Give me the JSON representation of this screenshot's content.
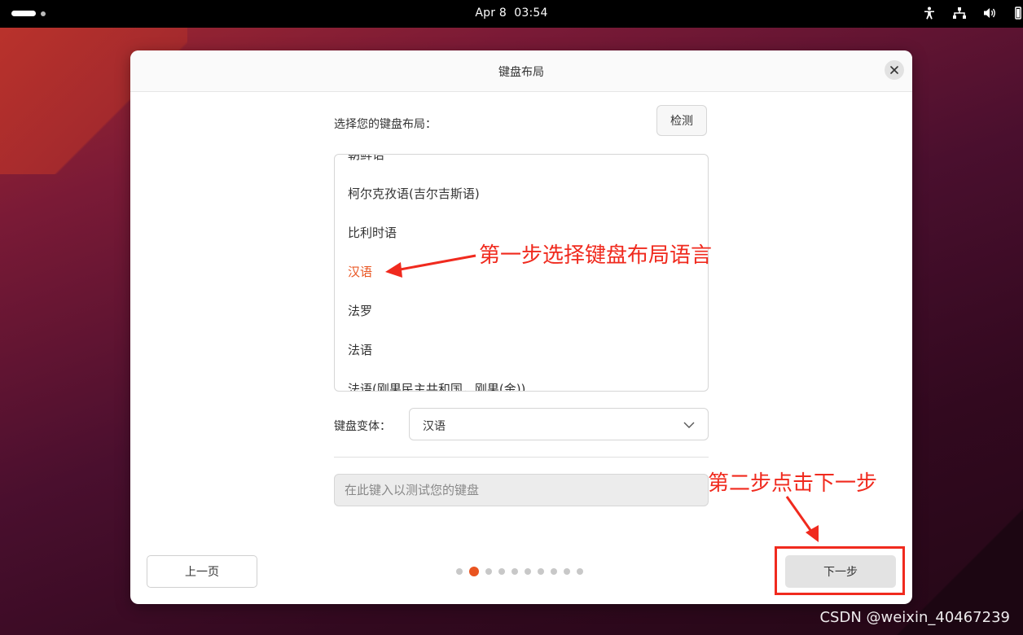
{
  "topbar": {
    "date": "Apr 8",
    "time": "03:54",
    "icons": [
      "accessibility-icon",
      "network-icon",
      "volume-icon",
      "battery-icon"
    ]
  },
  "dialog": {
    "title": "键盘布局",
    "prompt": "选择您的键盘布局：",
    "detect_label": "检测",
    "layouts": [
      "朝鲜语",
      "柯尔克孜语(吉尔吉斯语)",
      "比利时语",
      "汉语",
      "法罗",
      "法语",
      "法语(刚果民主共和国，刚果(金))"
    ],
    "selected_layout": "汉语",
    "variant_label": "键盘变体：",
    "variant_value": "汉语",
    "test_placeholder": "在此键入以测试您的键盘",
    "back_label": "上一页",
    "next_label": "下一步",
    "pager": {
      "total": 10,
      "current": 2
    }
  },
  "annotations": {
    "step1": "第一步选择键盘布局语言",
    "step2": "第二步点击下一步"
  },
  "watermark": "CSDN @weixin_40467239",
  "colors": {
    "accent": "#e95420",
    "annotation": "#f02a1e"
  }
}
